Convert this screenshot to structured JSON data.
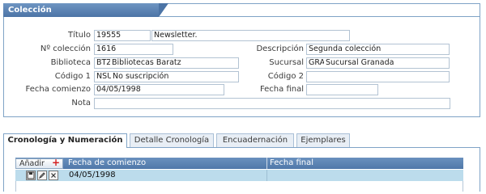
{
  "panel": {
    "title": "Colección"
  },
  "form": {
    "titulo_label": "Título",
    "titulo_code": "19555",
    "titulo_value": "Newsletter.",
    "numero_label": "Nº colección",
    "numero_value": "1616",
    "descripcion_label": "Descripción",
    "descripcion_value": "Segunda colección",
    "biblioteca_label": "Biblioteca",
    "biblioteca_code": "BTZ",
    "biblioteca_value": "Bibliotecas Baratz",
    "sucursal_label": "Sucursal",
    "sucursal_code": "GRA",
    "sucursal_value": "Sucursal Granada",
    "codigo1_label": "Código 1",
    "codigo1_code": "NSU",
    "codigo1_value": "No suscripción",
    "codigo2_label": "Código 2",
    "codigo2_value": "",
    "fecha_comienzo_label": "Fecha comienzo",
    "fecha_comienzo_value": "04/05/1998",
    "fecha_final_label": "Fecha final",
    "fecha_final_value": "",
    "nota_label": "Nota",
    "nota_value": ""
  },
  "tabs": [
    {
      "label": "Cronología y Numeración",
      "active": true
    },
    {
      "label": "Detalle Cronología",
      "active": false
    },
    {
      "label": "Encuadernación",
      "active": false
    },
    {
      "label": "Ejemplares",
      "active": false
    }
  ],
  "grid": {
    "add_label": "Añadir",
    "add_icon": "plus-icon",
    "columns": [
      "Fecha de comienzo",
      "Fecha final"
    ],
    "rows": [
      {
        "fecha_comienzo": "04/05/1998",
        "fecha_final": ""
      }
    ],
    "row_icons": [
      "save-icon",
      "edit-icon",
      "delete-icon"
    ]
  },
  "colors": {
    "header_blue": "#4c74a6",
    "border_blue": "#7fa3c6",
    "row_highlight": "#bcdcec",
    "add_plus": "#d42020"
  }
}
